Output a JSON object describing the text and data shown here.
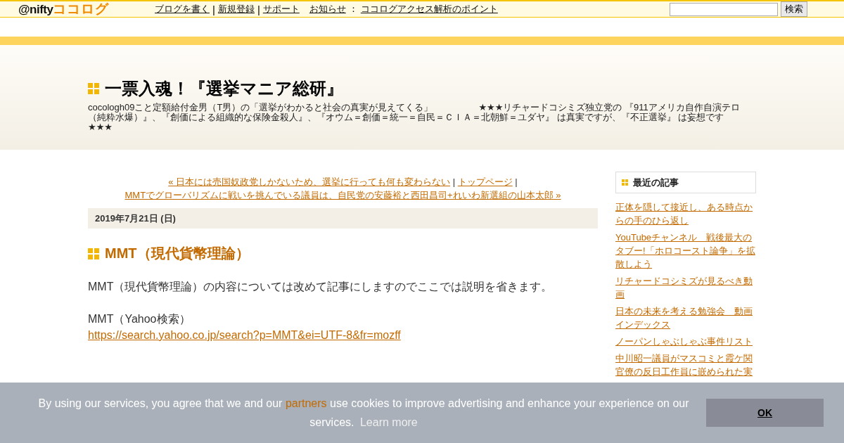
{
  "topbar": {
    "logo_prefix": "@nifty",
    "logo_main": "ココログ",
    "links": [
      {
        "label": "ブログを書く",
        "separator": "|"
      },
      {
        "label": "新規登録",
        "separator": "|"
      },
      {
        "label": "サポート"
      }
    ],
    "notice_label": "お知らせ",
    "notice_colon": "：",
    "notice_link": "ココログアクセス解析のポイント",
    "search": {
      "button": "検索"
    }
  },
  "header": {
    "title": "一票入魂！『選挙マニア総研』",
    "description": "cocologh09こと定額給付金男（T男）の「選挙がわかると社会の真実が見えてくる」　　　　　★★★リチャードコシミズ独立党の 『911アメリカ自作自演テロ（純粋水爆）』、『創価による組織的な保険金殺人』、『オウム＝創価＝統一＝自民＝ＣＩＡ＝北朝鮮＝ユダヤ』 は真実ですが、『不正選挙』 は妄想です★★★"
  },
  "nav": {
    "prev": "« 日本には売国奴政党しかないため、選挙に行っても何も変わらない",
    "sep1": "|",
    "top": "トップページ",
    "sep2": "|",
    "next": "MMTでグローバリズムに戦いを挑んでいる議員は、自民党の安藤裕と西田昌司+れいわ新選組の山本太郎 »"
  },
  "date": "2019年7月21日 (日)",
  "entry": {
    "title": "MMT（現代貨幣理論）",
    "paragraphs": [
      "MMT（現代貨幣理論）の内容については改めて記事にしますのでここでは説明を省きます。"
    ],
    "link_label": "MMT（Yahoo検索）",
    "link": "https://search.yahoo.co.jp/search?p=MMT&ei=UTF-8&fr=mozff"
  },
  "sidebar": {
    "heading": "最近の記事",
    "items": [
      "正体を隠して接近し、ある時点からの手のひら返し",
      "YouTubeチャンネル　戦後最大のタブー!「ホロコースト論争」を拡散しよう",
      "リチャードコシミズが見るべき動画",
      "日本の未来を考える勉強会　動画インデックス",
      "ノーパンしゃぶしゃぶ事件リスト",
      "中川昭一議員がマスコミと霞ケ関官僚の反日工作員に嵌められた実"
    ]
  },
  "cookie": {
    "before": "By using our services, you agree that we and our",
    "partners": "partners",
    "after": "use cookies to improve advertising and enhance your experience on our services.",
    "learn_more": "Learn more",
    "button": "OK"
  }
}
